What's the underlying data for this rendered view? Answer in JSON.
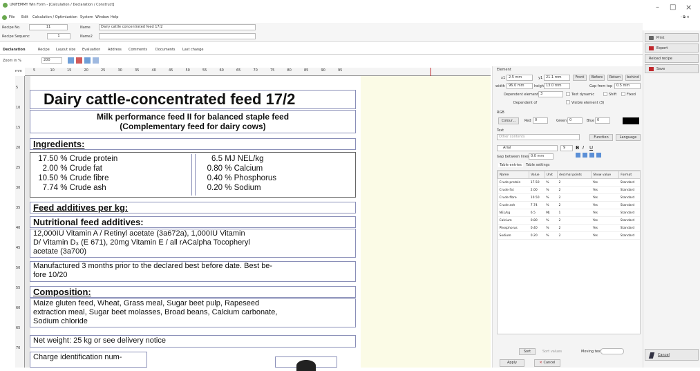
{
  "window": {
    "title": "UNIFEMMY Win Form - [Calculation / Declaration / Construct]",
    "minimize": "–",
    "maximize": "□",
    "close": "×",
    "restore": "- ⧉ ×"
  },
  "menu": [
    "File",
    "Edit",
    "Calculation / Optimization",
    "System",
    "Window",
    "Help"
  ],
  "recipe": {
    "no_label": "Recipe No.",
    "no_value": "11",
    "name_label": "Name",
    "name_value": "Dairy cattle concentrated feed 17/2",
    "seq_label": "Recipe Sequenc",
    "seq_value": "1",
    "name2_label": "Name2",
    "name2_value": ""
  },
  "tabs": [
    "Declaration",
    "Recipe",
    "Layout size",
    "Evaluation",
    "Address",
    "Comments",
    "Documents",
    "Last change"
  ],
  "zoom": {
    "label": "Zoom in %",
    "value": "200"
  },
  "doc": {
    "title": "Dairy cattle-concentrated feed 17/2",
    "subtitle1": "Milk performance feed II for balanced staple feed",
    "subtitle2": "(Complementary feed for dairy cows)",
    "ingredients_heading": "Ingredients:",
    "ing_left": [
      {
        "value": "17.50",
        "unit": "%",
        "name": "Crude protein"
      },
      {
        "value": "2.00",
        "unit": "%",
        "name": "Crude fat"
      },
      {
        "value": "10.50",
        "unit": "%",
        "name": "Crude fibre"
      },
      {
        "value": "7.74",
        "unit": "%",
        "name": "Crude ash"
      }
    ],
    "ing_right": [
      {
        "value": "6.5",
        "unit": "MJ",
        "name": "NEL/kg"
      },
      {
        "value": "0.80",
        "unit": "%",
        "name": "Calcium"
      },
      {
        "value": "0.40",
        "unit": "%",
        "name": "Phosphorus"
      },
      {
        "value": "0.20",
        "unit": "%",
        "name": "Sodium"
      }
    ],
    "additives_heading": "Feed additives per kg:",
    "nutritional_heading": "Nutritional feed additives:",
    "nutritional_text_1": "12,000IU  Vitamin A / Retinyl acetate (3a672a), 1,000IU  Vitamin",
    "nutritional_text_2": "D/ Vitamin D₃ (E 671), 20mg  Vitamin E / all rACalpha Tocopheryl",
    "nutritional_text_3": "acetate (3a700)",
    "manufactured_1": "Manufactured 3 months prior to the declared best before date. Best be-",
    "manufactured_2": "fore 10/20",
    "composition_heading": "Composition:",
    "composition_1": "Maize gluten feed, Wheat, Grass meal, Sugar beet pulp, Rapeseed",
    "composition_2": "extraction meal, Sugar beet molasses, Broad beans, Calcium carbonate,",
    "composition_3": "Sodium chloride",
    "net_weight": "Net weight: 25 kg or see delivery notice",
    "charge": "Charge identification num-"
  },
  "ruler_numbers": [
    "5",
    "10",
    "15",
    "20",
    "25",
    "30",
    "35",
    "40",
    "45",
    "50",
    "55",
    "60",
    "65",
    "70",
    "75",
    "80",
    "85",
    "90",
    "95"
  ],
  "left_ruler_numbers": [
    "5",
    "10",
    "15",
    "20",
    "25",
    "30",
    "35",
    "40",
    "45",
    "50",
    "55",
    "60",
    "65",
    "70"
  ],
  "props": {
    "element_label": "Element",
    "x_label": "x1",
    "x_value": "2.5 mm",
    "y_label": "y1",
    "y_value": "21.1 mm",
    "width_label": "width",
    "width_value": "96.0 mm",
    "height_label": "height",
    "height_value": "13.0 mm",
    "front": "Front",
    "before": "Before",
    "return": "Return",
    "behind": "behind",
    "gap_label": "Gap from top",
    "gap_value": "0.5 mm",
    "dep_label": "Dependent element",
    "dep_value": "3",
    "text_dynamic": "Text dynamic",
    "shift": "Shift",
    "fixed": "Fixed",
    "dep_of": "Dependent of",
    "visible": "Visible element (3)",
    "rgb_label": "RGB",
    "colour_btn": "Colour...",
    "red_label": "Red",
    "red_value": "0",
    "green_label": "Green",
    "green_value": "0",
    "blue_label": "Blue",
    "blue_value": "0",
    "text_label": "Text",
    "text_value": "Other contents",
    "function_btn": "Function",
    "language_btn": "Language",
    "font_value": "Arial",
    "font_size": "9",
    "gap_lines_label": "Gap between lines",
    "gap_lines_value": "0.0 mm",
    "table_tabs": [
      "Table entries",
      "Table settings"
    ],
    "table_headers": [
      "Name",
      "Value",
      "Unit",
      "decimal points",
      "Show value",
      "Format"
    ],
    "table_rows": [
      [
        "Crude protein",
        "17.50",
        "%",
        "2",
        "Yes",
        "Standard"
      ],
      [
        "Crude fat",
        "2.00",
        "%",
        "2",
        "Yes",
        "Standard"
      ],
      [
        "Crude fibre",
        "10.50",
        "%",
        "2",
        "Yes",
        "Standard"
      ],
      [
        "Crude ash",
        "7.74",
        "%",
        "2",
        "Yes",
        "Standard"
      ],
      [
        "NEL/kg",
        "6.5",
        "MJ",
        "1",
        "Yes",
        "Standard"
      ],
      [
        "Calcium",
        "0.80",
        "%",
        "2",
        "Yes",
        "Standard"
      ],
      [
        "Phosphorus",
        "0.40",
        "%",
        "2",
        "Yes",
        "Standard"
      ],
      [
        "Sodium",
        "0.20",
        "%",
        "2",
        "Yes",
        "Standard"
      ]
    ],
    "sort_btn": "Sort",
    "sort_values": "Sort values",
    "moving_text": "Moving text",
    "apply_btn": "Apply",
    "cancel_btn": "Cancel"
  },
  "right_actions": {
    "print": "Print",
    "export": "Export",
    "reload": "Reload recipe",
    "save": "Save",
    "cancel": "Cancel"
  },
  "colors": {
    "canvas_bg": "#fbfbe6",
    "border_blue": "#8a8fb8",
    "accent_red": "#c0282d"
  }
}
